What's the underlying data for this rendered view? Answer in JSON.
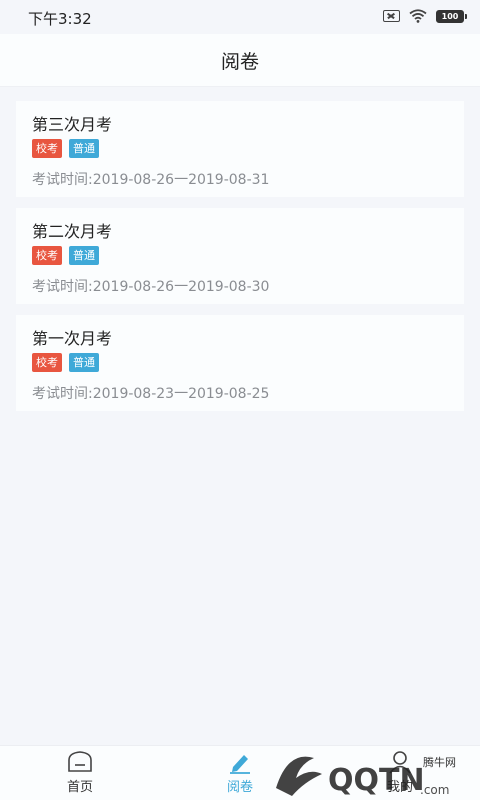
{
  "status": {
    "time": "下午3:32",
    "battery": "100"
  },
  "header": {
    "title": "阅卷"
  },
  "exams": [
    {
      "title": "第三次月考",
      "tags": [
        "校考",
        "普通"
      ],
      "time": "考试时间:2019-08-26一2019-08-31"
    },
    {
      "title": "第二次月考",
      "tags": [
        "校考",
        "普通"
      ],
      "time": "考试时间:2019-08-26一2019-08-30"
    },
    {
      "title": "第一次月考",
      "tags": [
        "校考",
        "普通"
      ],
      "time": "考试时间:2019-08-23一2019-08-25"
    }
  ],
  "nav": {
    "items": [
      {
        "label": "首页",
        "icon": "home-icon"
      },
      {
        "label": "阅卷",
        "icon": "pencil-icon",
        "active": true
      },
      {
        "label": "我的",
        "icon": "user-icon"
      }
    ]
  },
  "watermark": {
    "site": "腾牛网",
    "logo": "QQTN.com"
  },
  "colors": {
    "accent": "#3fa9d8",
    "tag_school": "#e85640",
    "tag_normal": "#3fa9d8"
  }
}
